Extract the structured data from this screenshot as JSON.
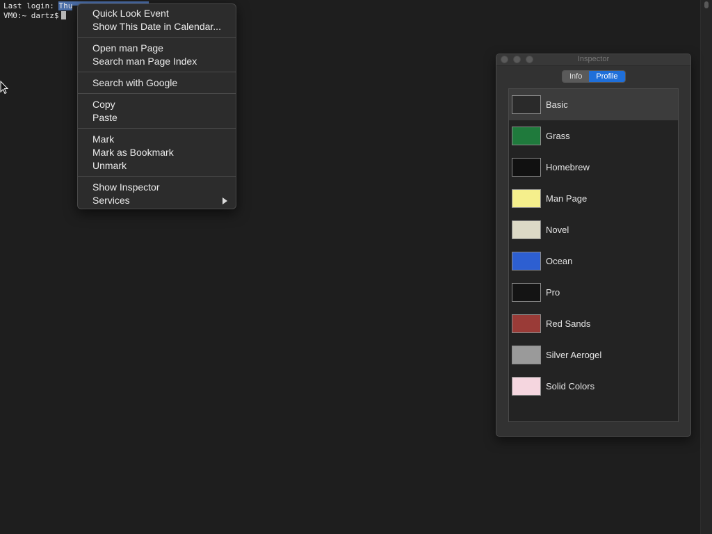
{
  "terminal": {
    "login_prefix": "Last login: ",
    "login_selected": "Thu",
    "prompt": "VM0:~ dartz$"
  },
  "context_menu": {
    "groups": [
      {
        "items": [
          {
            "label": "Quick Look Event"
          },
          {
            "label": "Show This Date in Calendar..."
          }
        ]
      },
      {
        "items": [
          {
            "label": "Open man Page"
          },
          {
            "label": "Search man Page Index"
          }
        ]
      },
      {
        "items": [
          {
            "label": "Search with Google"
          }
        ]
      },
      {
        "items": [
          {
            "label": "Copy"
          },
          {
            "label": "Paste"
          }
        ]
      },
      {
        "items": [
          {
            "label": "Mark"
          },
          {
            "label": "Mark as Bookmark"
          },
          {
            "label": "Unmark"
          }
        ]
      },
      {
        "items": [
          {
            "label": "Show Inspector"
          },
          {
            "label": "Services",
            "submenu": true
          }
        ]
      }
    ]
  },
  "inspector": {
    "title": "Inspector",
    "tabs": [
      {
        "label": "Info",
        "active": false
      },
      {
        "label": "Profile",
        "active": true
      }
    ],
    "profiles": [
      {
        "name": "Basic",
        "color": "#2a2a2a",
        "selected": true
      },
      {
        "name": "Grass",
        "color": "#1f7a3c",
        "selected": false
      },
      {
        "name": "Homebrew",
        "color": "#111111",
        "selected": false
      },
      {
        "name": "Man Page",
        "color": "#f5ef8c",
        "selected": false
      },
      {
        "name": "Novel",
        "color": "#dcd9c6",
        "selected": false
      },
      {
        "name": "Ocean",
        "color": "#2d5fd1",
        "selected": false
      },
      {
        "name": "Pro",
        "color": "#141414",
        "selected": false
      },
      {
        "name": "Red Sands",
        "color": "#9a3b37",
        "selected": false
      },
      {
        "name": "Silver Aerogel",
        "color": "#9a9a9a",
        "selected": false
      },
      {
        "name": "Solid Colors",
        "color": "#f5d6df",
        "selected": false
      }
    ]
  }
}
